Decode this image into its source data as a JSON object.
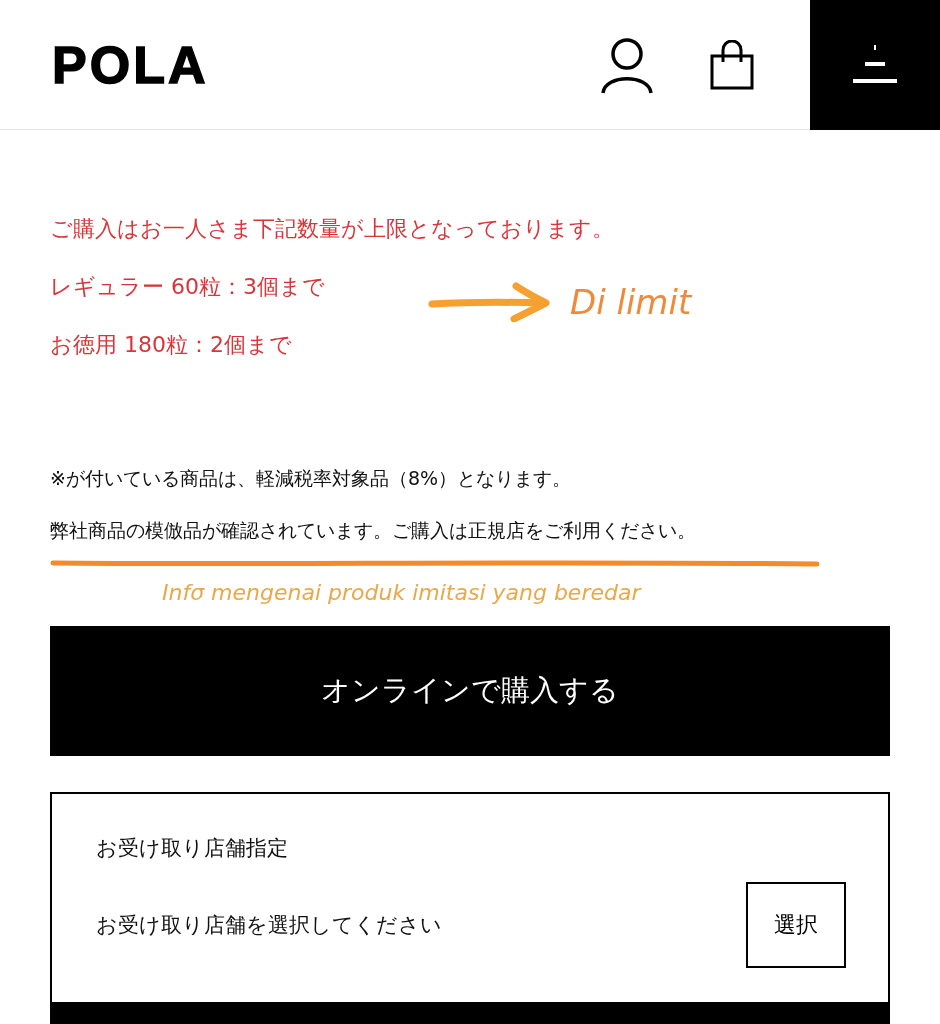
{
  "header": {
    "logo": "POLA"
  },
  "limit_notice": {
    "lines": [
      "ご購入はお一人さま下記数量が上限となっております。",
      "レギュラー 60粒：3個まで",
      "お徳用 180粒：2個まで"
    ]
  },
  "annotations": [
    {
      "kind": "arrow_note",
      "text": "Di limit"
    },
    {
      "kind": "underline_note",
      "text": "Infσ mengenai produk imitasi yang beredar"
    }
  ],
  "notes": [
    "※が付いている商品は、軽減税率対象品（8%）となります。",
    "弊社商品の模倣品が確認されています。ご購入は正規店をご利用ください。"
  ],
  "buy_button": "オンラインで購入する",
  "store_pickup": {
    "title": "お受け取り店舗指定",
    "prompt": "お受け取り店舗を選択してください",
    "select_button": "選択"
  }
}
